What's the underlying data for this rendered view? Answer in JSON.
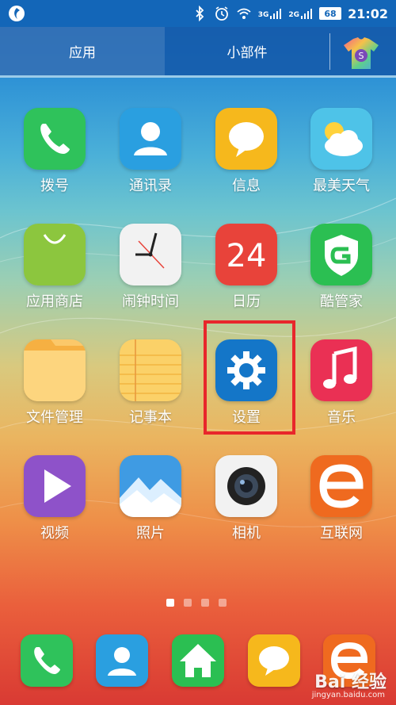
{
  "status_bar": {
    "network_1": "3G",
    "network_2": "2G",
    "battery": "68",
    "time": "21:02"
  },
  "tabs": {
    "apps": "应用",
    "widgets": "小部件",
    "theme_letter": "S"
  },
  "apps": [
    {
      "label": "拨号",
      "icon": "phone-icon",
      "color": "#2fc25b"
    },
    {
      "label": "通讯录",
      "icon": "contact-icon",
      "color": "#2a9fe0"
    },
    {
      "label": "信息",
      "icon": "message-icon",
      "color": "#f6b81c"
    },
    {
      "label": "最美天气",
      "icon": "weather-icon",
      "color": "#4ec3e8"
    },
    {
      "label": "应用商店",
      "icon": "store-bag-icon",
      "color": "#8cc63e"
    },
    {
      "label": "闹钟时间",
      "icon": "clock-icon",
      "color": "#f2f2f2"
    },
    {
      "label": "日历",
      "icon": "calendar-icon",
      "color": "#e8433a",
      "day": "24"
    },
    {
      "label": "酷管家",
      "icon": "shield-icon",
      "color": "#2bbf52"
    },
    {
      "label": "文件管理",
      "icon": "folder-icon",
      "color": "#fbc86a"
    },
    {
      "label": "记事本",
      "icon": "notepad-icon",
      "color": "#fbd168"
    },
    {
      "label": "设置",
      "icon": "gear-icon",
      "color": "#1476c8"
    },
    {
      "label": "音乐",
      "icon": "music-note-icon",
      "color": "#ea3054"
    },
    {
      "label": "视频",
      "icon": "play-icon",
      "color": "#8e52c9"
    },
    {
      "label": "照片",
      "icon": "mountain-icon",
      "color": "#3f9be3"
    },
    {
      "label": "相机",
      "icon": "camera-lens-icon",
      "color": "#f2f2f2"
    },
    {
      "label": "互联网",
      "icon": "browser-e-icon",
      "color": "#ef6a1f"
    }
  ],
  "page_indicator": {
    "pages": 4,
    "current": 1
  },
  "dock": [
    {
      "icon": "phone-icon"
    },
    {
      "icon": "contact-icon"
    },
    {
      "icon": "home-icon"
    },
    {
      "icon": "message-icon"
    },
    {
      "icon": "browser-e-icon"
    }
  ],
  "watermark": {
    "text": "Bai 经验",
    "url": "jingyan.baidu.com"
  }
}
